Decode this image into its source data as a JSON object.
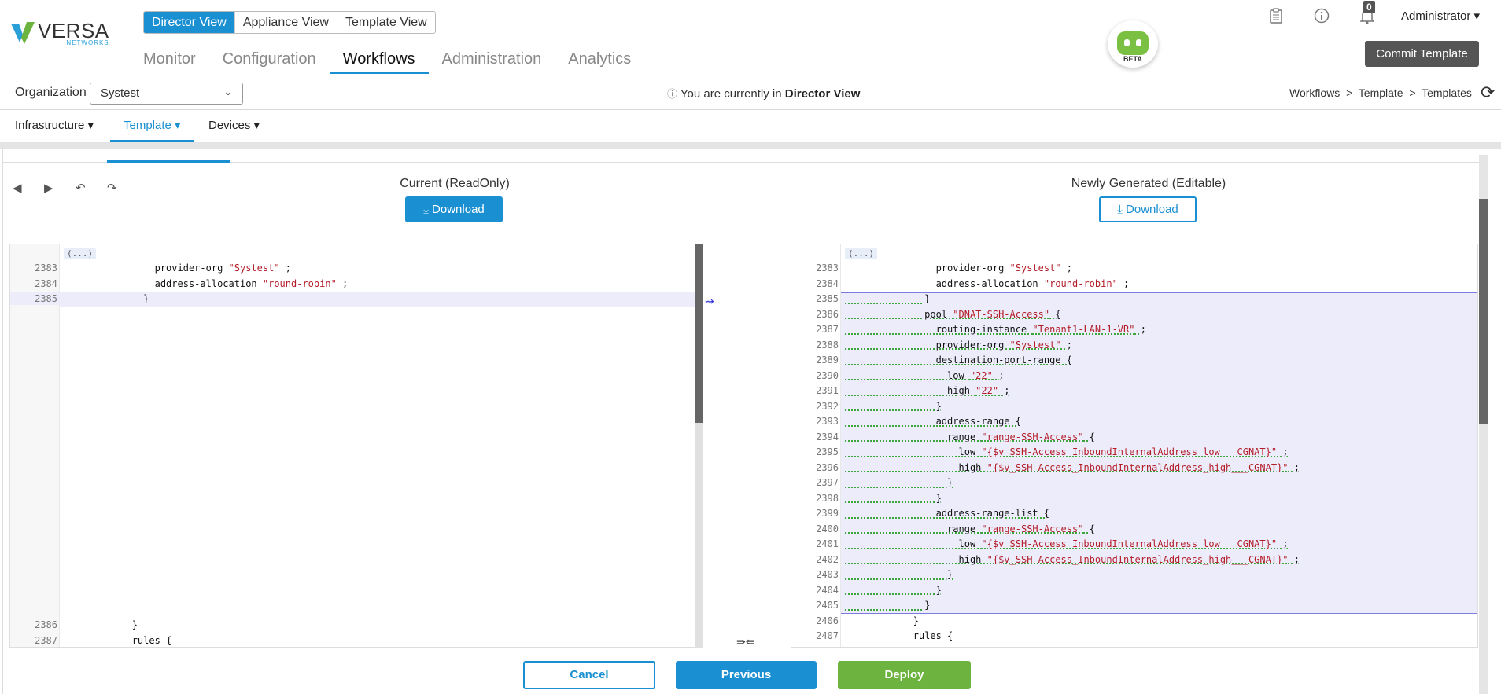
{
  "logo": {
    "name": "VERSA",
    "sub": "NETWORKS"
  },
  "view_tabs": [
    "Director View",
    "Appliance View",
    "Template View"
  ],
  "main_nav": [
    "Monitor",
    "Configuration",
    "Workflows",
    "Administration",
    "Analytics"
  ],
  "bot": {
    "badge": "BETA"
  },
  "header": {
    "notification_count": "0",
    "user": "Administrator ▾",
    "commit_label": "Commit Template"
  },
  "org": {
    "label": "Organization",
    "value": "Systest",
    "info_prefix": "You are currently in",
    "info_view": "Director View"
  },
  "breadcrumb": "Workflows  >  Template  >  Templates",
  "sub_nav": [
    "Infrastructure ▾",
    "Template ▾",
    "Devices ▾"
  ],
  "diff": {
    "left_title": "Current (ReadOnly)",
    "right_title": "Newly Generated (Editable)",
    "download_label": "Download",
    "fold": "(...)",
    "left_lines": [
      {
        "n": "2383",
        "code": "                provider-org ",
        "str": "\"Systest\"",
        "tail": " ;"
      },
      {
        "n": "2384",
        "code": "                address-allocation ",
        "str": "\"round-robin\"",
        "tail": " ;"
      },
      {
        "n": "2385",
        "code": "              }",
        "str": "",
        "tail": ""
      }
    ],
    "left_bottom": [
      {
        "n": "2386",
        "code": "            }"
      },
      {
        "n": "2387",
        "code": "            rules {"
      }
    ],
    "right_lines": [
      {
        "n": "2383",
        "code": "                provider-org ",
        "str": "\"Systest\"",
        "tail": " ;"
      },
      {
        "n": "2384",
        "code": "                address-allocation ",
        "str": "\"round-robin\"",
        "tail": " ;"
      },
      {
        "n": "2385",
        "code": "              }",
        "str": "",
        "tail": ""
      },
      {
        "n": "2386",
        "code": "              pool ",
        "str": "\"DNAT-SSH-Access\"",
        "tail": " {"
      },
      {
        "n": "2387",
        "code": "                routing-instance ",
        "str": "\"Tenant1-LAN-1-VR\"",
        "tail": " ;"
      },
      {
        "n": "2388",
        "code": "                provider-org ",
        "str": "\"Systest\"",
        "tail": " ;"
      },
      {
        "n": "2389",
        "code": "                destination-port-range {",
        "str": "",
        "tail": ""
      },
      {
        "n": "2390",
        "code": "                  low ",
        "str": "\"22\"",
        "tail": " ;"
      },
      {
        "n": "2391",
        "code": "                  high ",
        "str": "\"22\"",
        "tail": " ;"
      },
      {
        "n": "2392",
        "code": "                }",
        "str": "",
        "tail": ""
      },
      {
        "n": "2393",
        "code": "                address-range {",
        "str": "",
        "tail": ""
      },
      {
        "n": "2394",
        "code": "                  range ",
        "str": "\"range-SSH-Access\"",
        "tail": " {"
      },
      {
        "n": "2395",
        "code": "                    low ",
        "str": "\"{$v_SSH-Access_InboundInternalAddress_low___CGNAT}\"",
        "tail": " ;"
      },
      {
        "n": "2396",
        "code": "                    high ",
        "str": "\"{$v_SSH-Access_InboundInternalAddress_high___CGNAT}\"",
        "tail": " ;"
      },
      {
        "n": "2397",
        "code": "                  }",
        "str": "",
        "tail": ""
      },
      {
        "n": "2398",
        "code": "                }",
        "str": "",
        "tail": ""
      },
      {
        "n": "2399",
        "code": "                address-range-list {",
        "str": "",
        "tail": ""
      },
      {
        "n": "2400",
        "code": "                  range ",
        "str": "\"range-SSH-Access\"",
        "tail": " {"
      },
      {
        "n": "2401",
        "code": "                    low ",
        "str": "\"{$v_SSH-Access_InboundInternalAddress_low___CGNAT}\"",
        "tail": " ;"
      },
      {
        "n": "2402",
        "code": "                    high ",
        "str": "\"{$v_SSH-Access_InboundInternalAddress_high___CGNAT}\"",
        "tail": " ;"
      },
      {
        "n": "2403",
        "code": "                  }",
        "str": "",
        "tail": ""
      },
      {
        "n": "2404",
        "code": "                }",
        "str": "",
        "tail": ""
      },
      {
        "n": "2405",
        "code": "              }",
        "str": "",
        "tail": ""
      },
      {
        "n": "2406",
        "code": "            }",
        "str": "",
        "tail": ""
      },
      {
        "n": "2407",
        "code": "            rules {",
        "str": "",
        "tail": ""
      }
    ]
  },
  "footer": {
    "cancel": "Cancel",
    "previous": "Previous",
    "deploy": "Deploy"
  }
}
